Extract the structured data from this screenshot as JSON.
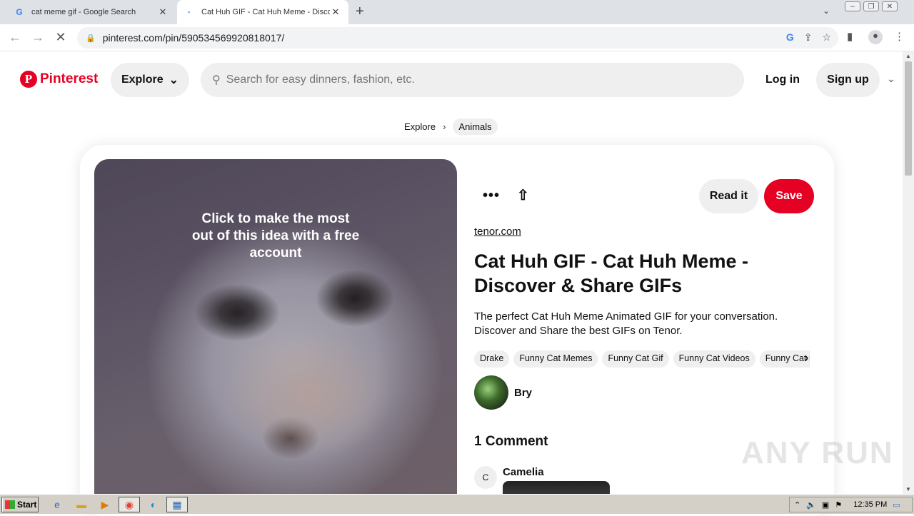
{
  "browser": {
    "tabs": [
      {
        "title": "cat meme gif - Google Search",
        "favicon": "G",
        "active": false
      },
      {
        "title": "Cat Huh GIF - Cat Huh Meme - Disco",
        "favicon": "·",
        "active": true
      }
    ],
    "url": "pinterest.com/pin/590534569920818017/"
  },
  "header": {
    "brand": "Pinterest",
    "explore_label": "Explore",
    "search_placeholder": "Search for easy dinners, fashion, etc.",
    "login_label": "Log in",
    "signup_label": "Sign up"
  },
  "breadcrumb": {
    "items": [
      "Explore",
      "Animals"
    ]
  },
  "pin": {
    "image_caption": "Click to make the most out of this idea with a free account",
    "read_it_label": "Read it",
    "save_label": "Save",
    "source": "tenor.com",
    "title": "Cat Huh GIF - Cat Huh Meme - Discover & Share GIFs",
    "description": "The perfect Cat Huh Meme Animated GIF for your conversation. Discover and Share the best GIFs on Tenor.",
    "tags": [
      "Drake",
      "Funny Cat Memes",
      "Funny Cat Gif",
      "Funny Cat Videos",
      "Funny Cat Pictures"
    ],
    "author": "Bry",
    "comments_heading": "1 Comment",
    "comment_author_initial": "C",
    "comment_author": "Camelia"
  },
  "watermark": "ANY RUN",
  "taskbar": {
    "start_label": "Start",
    "clock": "12:35 PM"
  },
  "colors": {
    "brand_red": "#e60023",
    "pill_gray": "#efefef"
  }
}
